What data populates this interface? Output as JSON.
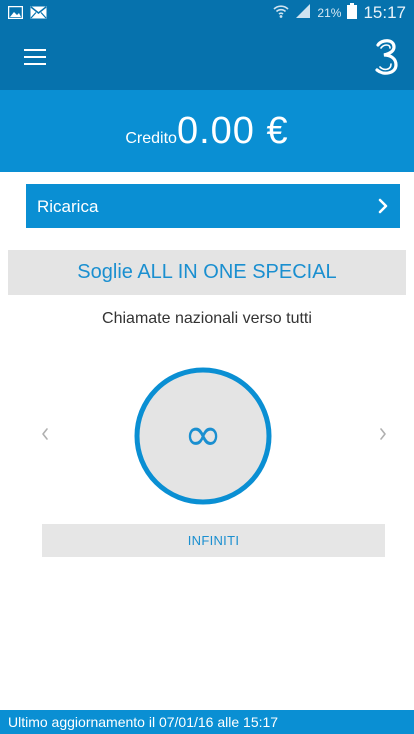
{
  "status_bar": {
    "left_icons": [
      "gallery-icon",
      "mail-icon"
    ],
    "right_icons": [
      "wifi-icon",
      "signal-icon",
      "battery-icon"
    ],
    "battery_percent": "21%",
    "time": "15:17"
  },
  "header": {
    "menu_icon": "hamburger-menu-icon",
    "logo_icon": "three-brand-logo"
  },
  "credit": {
    "label": "Credito",
    "value": "0.00 €"
  },
  "ricarica": {
    "label": "Ricarica",
    "icon": "chevron-right-icon"
  },
  "thresholds": {
    "title": "Soglie ALL IN ONE SPECIAL",
    "current_item": "Chiamate nazionali verso tutti",
    "gauge_value": "∞",
    "status": "INFINITI"
  },
  "footer": {
    "last_update": "Ultimo aggiornamento il 07/01/16 alle 15:17"
  },
  "colors": {
    "header_bg": "#0672ad",
    "accent": "#0a8fd3",
    "title_blue": "#1a8fd0",
    "panel_gray": "#e4e4e4"
  }
}
